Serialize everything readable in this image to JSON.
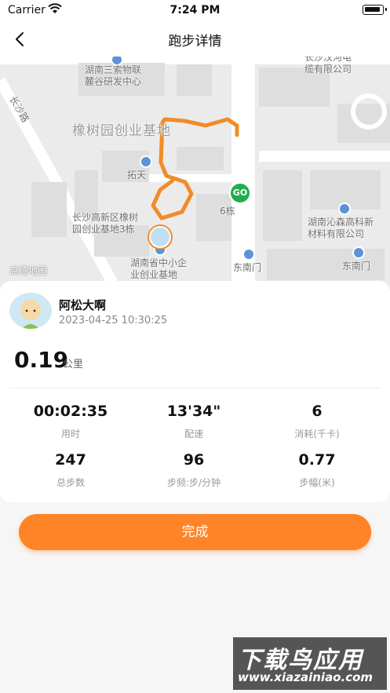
{
  "status": {
    "carrier": "Carrier",
    "time": "7:24 PM"
  },
  "nav": {
    "title": "跑步详情"
  },
  "map": {
    "labels": {
      "poi1": "湖南三索物联\n麓谷研发中心",
      "poi2": "长沙汉河电\n缆有限公司",
      "area": "橡树园创业基地",
      "road": "长沙路",
      "poi3": "拓天",
      "poi4": "长沙高新区橡树\n园创业基地3栋",
      "bldg": "6栋",
      "poi5": "湖南沁森高科新\n材料有限公司",
      "poi6": "湖南省中小企\n业创业基地",
      "gate1": "东南门",
      "gate2": "东南门",
      "logo": "高德地图"
    },
    "go_label": "GO"
  },
  "user": {
    "name": "阿松大啊",
    "date": "2023-04-25 10:30:25"
  },
  "distance": {
    "value": "0.19",
    "unit": "公里"
  },
  "stats": [
    {
      "value": "00:02:35",
      "label": "用时"
    },
    {
      "value": "13'34\"",
      "label": "配速"
    },
    {
      "value": "6",
      "label": "消耗(千卡)"
    },
    {
      "value": "247",
      "label": "总步数"
    },
    {
      "value": "96",
      "label": "步频:步/分钟"
    },
    {
      "value": "0.77",
      "label": "步幅(米)"
    }
  ],
  "done_button": "完成",
  "watermark": {
    "line1": "下载鸟应用",
    "line2": "www.xiazainiao.com"
  },
  "colors": {
    "accent": "#ff8427",
    "route": "#f08c2a",
    "go": "#1fae4e"
  }
}
